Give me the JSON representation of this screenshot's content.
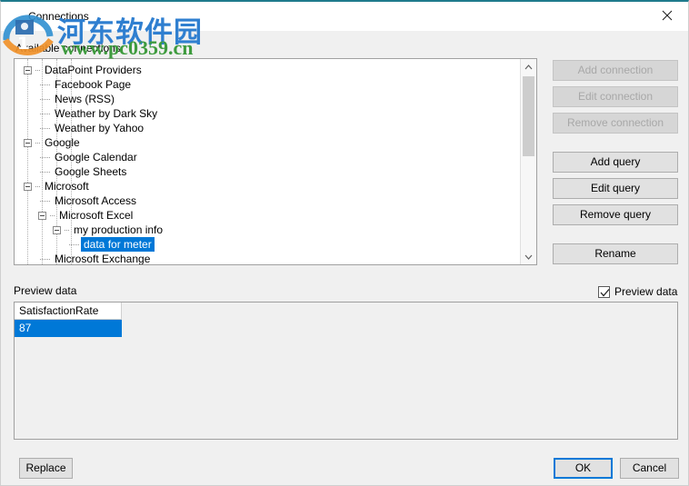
{
  "window": {
    "title": "Connections",
    "close_icon": "close-icon",
    "accent_color": "#1f7a8c"
  },
  "labels": {
    "available_connections": "Available connections",
    "preview_data": "Preview data"
  },
  "tree": {
    "selection_color": "#0078d7",
    "items": [
      {
        "label": "DataPoint Providers",
        "depth": 0,
        "expander": "collapse",
        "selected": false
      },
      {
        "label": "Facebook Page",
        "depth": 1,
        "expander": "none",
        "selected": false
      },
      {
        "label": "News (RSS)",
        "depth": 1,
        "expander": "none",
        "selected": false
      },
      {
        "label": "Weather by Dark Sky",
        "depth": 1,
        "expander": "none",
        "selected": false
      },
      {
        "label": "Weather by Yahoo",
        "depth": 1,
        "expander": "none",
        "selected": false
      },
      {
        "label": "Google",
        "depth": 0,
        "expander": "collapse",
        "selected": false
      },
      {
        "label": "Google Calendar",
        "depth": 1,
        "expander": "none",
        "selected": false
      },
      {
        "label": "Google Sheets",
        "depth": 1,
        "expander": "none",
        "selected": false
      },
      {
        "label": "Microsoft",
        "depth": 0,
        "expander": "collapse",
        "selected": false
      },
      {
        "label": "Microsoft Access",
        "depth": 1,
        "expander": "none",
        "selected": false
      },
      {
        "label": "Microsoft Excel",
        "depth": 1,
        "expander": "collapse",
        "selected": false
      },
      {
        "label": "my production info",
        "depth": 2,
        "expander": "collapse",
        "selected": false
      },
      {
        "label": "data for meter",
        "depth": 3,
        "expander": "none",
        "selected": true
      },
      {
        "label": "Microsoft Exchange",
        "depth": 1,
        "expander": "none",
        "selected": false
      }
    ],
    "scrollbar": {
      "up_icon": "chevron-up-icon",
      "down_icon": "chevron-down-icon"
    }
  },
  "side_buttons": [
    {
      "label": "Add connection",
      "enabled": false
    },
    {
      "label": "Edit connection",
      "enabled": false
    },
    {
      "label": "Remove connection",
      "enabled": false
    },
    {
      "label": "Add query",
      "enabled": true
    },
    {
      "label": "Edit query",
      "enabled": true
    },
    {
      "label": "Remove query",
      "enabled": true
    },
    {
      "label": "Rename",
      "enabled": true
    }
  ],
  "preview_checkbox": {
    "label": "Preview data",
    "checked": true,
    "check_icon": "check-icon"
  },
  "preview_grid": {
    "columns": [
      "SatisfactionRate"
    ],
    "rows": [
      [
        "87"
      ]
    ],
    "selected_row_index": 0
  },
  "bottom_buttons": {
    "replace": "Replace",
    "ok": "OK",
    "cancel": "Cancel"
  },
  "watermark": {
    "chinese": "河东软件园",
    "url": "www.pc0359.cn"
  }
}
